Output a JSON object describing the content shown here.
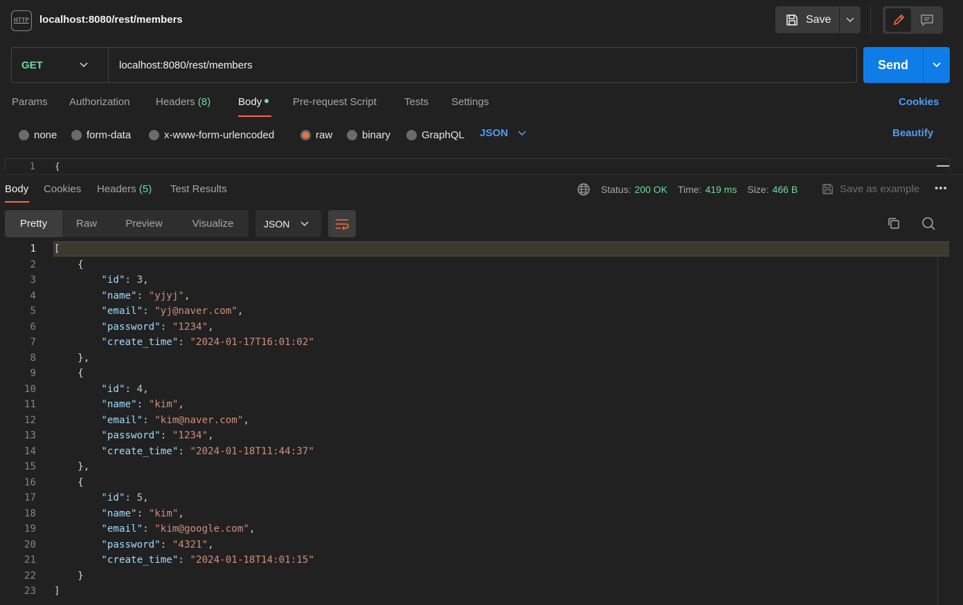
{
  "header": {
    "icon_label": "HTTP",
    "title": "localhost:8080/rest/members",
    "save_label": "Save"
  },
  "request": {
    "method": "GET",
    "url": "localhost:8080/rest/members",
    "send_label": "Send"
  },
  "request_tabs": [
    {
      "label": "Params",
      "count": ""
    },
    {
      "label": "Authorization",
      "count": ""
    },
    {
      "label": "Headers",
      "count": "(8)"
    },
    {
      "label": "Body",
      "count": ""
    },
    {
      "label": "Pre-request Script",
      "count": ""
    },
    {
      "label": "Tests",
      "count": ""
    },
    {
      "label": "Settings",
      "count": ""
    }
  ],
  "cookies_label": "Cookies",
  "body_types": [
    "none",
    "form-data",
    "x-www-form-urlencoded",
    "raw",
    "binary",
    "GraphQL"
  ],
  "body_type_selected": "raw",
  "body_format": "JSON",
  "beautify_label": "Beautify",
  "request_editor": {
    "line": "1",
    "text": "{"
  },
  "response_tabs": [
    {
      "label": "Body",
      "count": ""
    },
    {
      "label": "Cookies",
      "count": ""
    },
    {
      "label": "Headers",
      "count": "(5)"
    },
    {
      "label": "Test Results",
      "count": ""
    }
  ],
  "status": {
    "status_label": "Status:",
    "status_value": "200 OK",
    "time_label": "Time:",
    "time_value": "419 ms",
    "size_label": "Size:",
    "size_value": "466 B"
  },
  "save_example_label": "Save as example",
  "more_label": "•••",
  "view_modes": [
    "Pretty",
    "Raw",
    "Preview",
    "Visualize"
  ],
  "response_format": "JSON",
  "response_lines": [
    "[",
    "    {",
    "        \"id\": 3,",
    "        \"name\": \"yjyj\",",
    "        \"email\": \"yj@naver.com\",",
    "        \"password\": \"1234\",",
    "        \"create_time\": \"2024-01-17T16:01:02\"",
    "    },",
    "    {",
    "        \"id\": 4,",
    "        \"name\": \"kim\",",
    "        \"email\": \"kim@naver.com\",",
    "        \"password\": \"1234\",",
    "        \"create_time\": \"2024-01-18T11:44:37\"",
    "    },",
    "    {",
    "        \"id\": 5,",
    "        \"name\": \"kim\",",
    "        \"email\": \"kim@google.com\",",
    "        \"password\": \"4321\",",
    "        \"create_time\": \"2024-01-18T14:01:15\"",
    "    }",
    "]"
  ],
  "colors": {
    "accent_orange": "#ff6c37",
    "send_blue": "#0e7de8",
    "link_blue": "#4e9df5",
    "success_green": "#6bdd9a",
    "json_key": "#9cdcfe",
    "json_string": "#ce9178",
    "json_number": "#b5cea8"
  }
}
